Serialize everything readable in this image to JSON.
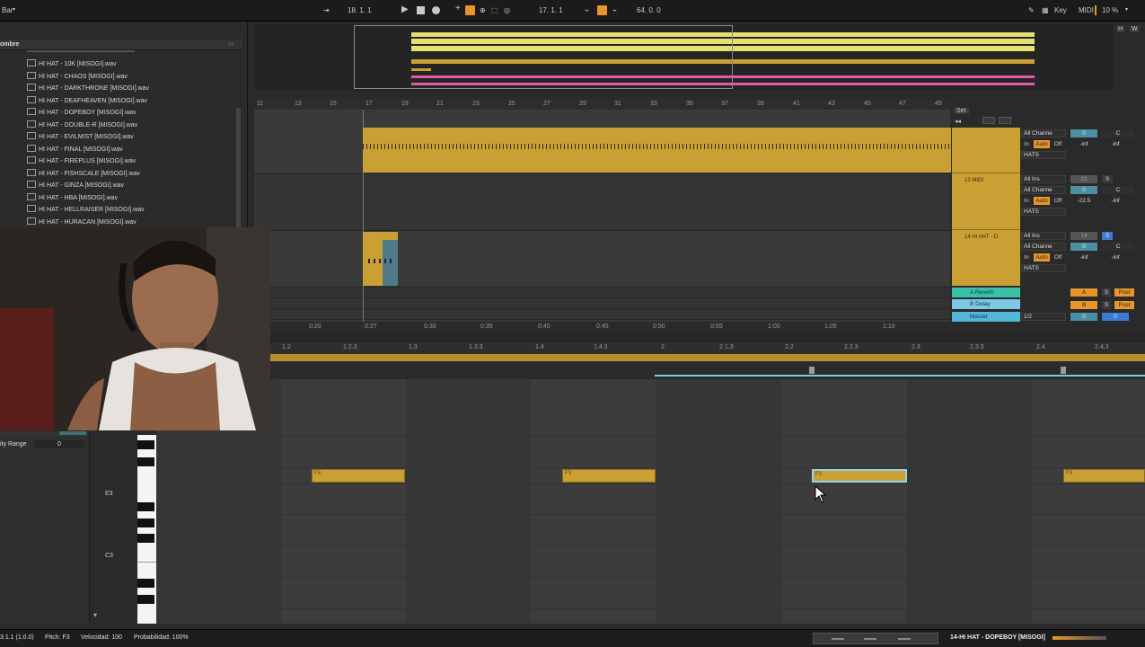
{
  "topbar": {
    "left_label": "Bar",
    "arr_position": "18.  1.  1",
    "loop_start": "17.  1.  1",
    "loop_length": "64.  0.  0",
    "key_label": "Key",
    "midi_label": "MIDI",
    "cpu_load": "10 %",
    "h_label": "H",
    "w_label": "W"
  },
  "browser": {
    "header": "ombre",
    "files": [
      "HI HAT - 10K [MISOGI].wav",
      "HI HAT - CHAOS [MISOGI].wav",
      "HI HAT - DARKTHRONE [MISOGI].wav",
      "HI HAT - DEAFHEAVEN [MISOGI].wav",
      "HI HAT - DOPEBOY [MISOGI].wav",
      "HI HAT - DOUBLE-R [MISOGI].wav",
      "HI HAT - EVILMIST [MISOGI].wav",
      "HI HAT - FINAL [MISOGI].wav",
      "HI HAT - FIREPLUS [MISOGI].wav",
      "HI HAT - FISHSCALE [MISOGI].wav",
      "HI HAT - GINZA [MISOGI].wav",
      "HI HAT - HBA [MISOGI].wav",
      "HI HAT - HELLRAISER [MISOGI].wav",
      "HI HAT - HURACAN [MISOGI].wav"
    ]
  },
  "arrangement": {
    "bar_ticks": [
      "11",
      "13",
      "15",
      "17",
      "19",
      "21",
      "23",
      "25",
      "27",
      "29",
      "31",
      "33",
      "35",
      "37",
      "39",
      "41",
      "43",
      "45",
      "47",
      "49"
    ],
    "time_ticks": [
      "0:20",
      "0:25",
      "0:30",
      "0:35",
      "0:40",
      "0:45",
      "0:50",
      "0:55",
      "1:00",
      "1:05",
      "1:10"
    ],
    "set_label": "Set"
  },
  "tracks": [
    {
      "name": "",
      "input": "All Channe",
      "monitor_in": "In",
      "monitor_auto": "Auto",
      "monitor_off": "Off",
      "output": "HATS",
      "vol": "0",
      "pan": "C",
      "peak1": "-inf",
      "peak2": "-inf"
    },
    {
      "name": "13 MIDI",
      "input_type": "All Ins",
      "input": "All Channe",
      "monitor_in": "In",
      "monitor_auto": "Auto",
      "monitor_off": "Off",
      "output": "HATS",
      "num": "13",
      "solo": "S",
      "vol": "0",
      "pan": "C",
      "peak1": "-22.5",
      "peak2": "-inf"
    },
    {
      "name": "14 HI HAT - D",
      "input_type": "All Ins",
      "input": "All Channe",
      "monitor_in": "In",
      "monitor_auto": "Auto",
      "monitor_off": "Off",
      "output": "HATS",
      "num": "14",
      "solo": "S",
      "vol": "0",
      "pan": "C",
      "peak1": "-inf",
      "peak2": "-inf"
    }
  ],
  "returns": [
    {
      "name": "A Reverb",
      "letter": "A",
      "solo": "S",
      "post": "Post"
    },
    {
      "name": "B Delay",
      "letter": "B",
      "solo": "S",
      "post": "Post"
    },
    {
      "name": "Master",
      "quantize": "1/2",
      "vol1": "0",
      "vol2": "0"
    }
  ],
  "clip": {
    "ruler_ticks": [
      "1.2",
      "1.2.3",
      "1.3",
      "1.3.3",
      "1.4",
      "1.4.3",
      "2",
      "2.1.3",
      "2.2",
      "2.2.3",
      "2.3",
      "2.3.3",
      "2.4",
      "2.4.3"
    ],
    "note_label": "F3",
    "key_e3": "E3",
    "key_c3": "C3",
    "velocity_range_label": "ity Range",
    "velocity_range_value": "0"
  },
  "status": {
    "position": "3.1.1 (1.0.0)",
    "pitch": "Pitch: F3",
    "velocity": "Velocidad: 100",
    "probability": "Probabilidad: 100%",
    "track_name": "14-HI HAT - DOPEBOY [MISOGI]"
  }
}
